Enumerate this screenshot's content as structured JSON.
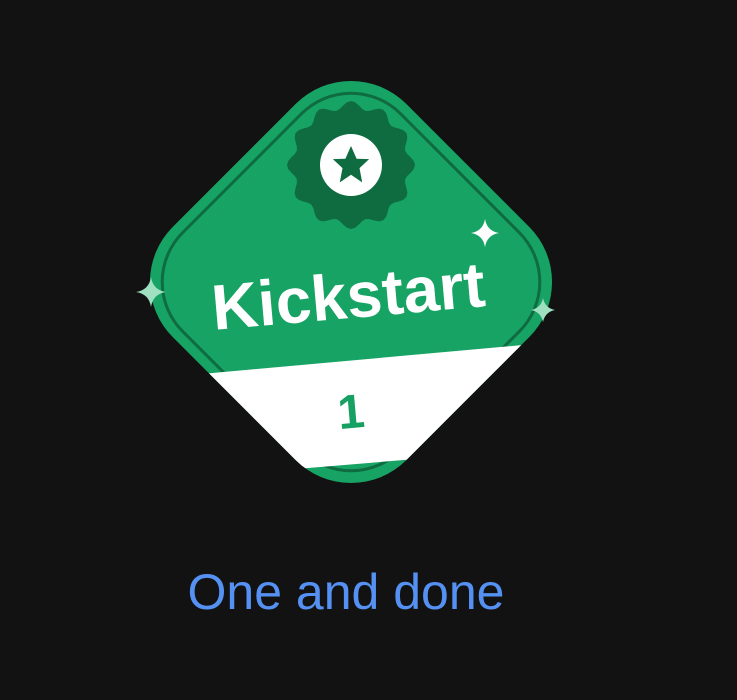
{
  "badge": {
    "title": "Kickstart",
    "level": "1",
    "icon": "star-seal-icon",
    "colors": {
      "primary": "#17a364",
      "dark": "#0f6b40",
      "ribbon": "#ffffff",
      "level_text": "#16a061",
      "title_text": "#ffffff",
      "sparkle": "#ffffff"
    }
  },
  "caption": {
    "text": "One and done",
    "color": "#5591f2"
  },
  "background": "#121212"
}
